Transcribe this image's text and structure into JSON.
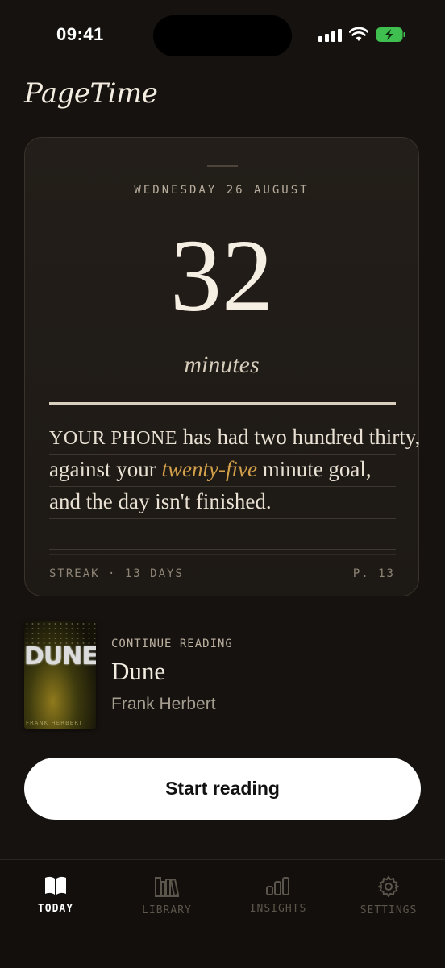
{
  "status_bar": {
    "time": "09:41"
  },
  "app": {
    "title": "PageTime"
  },
  "today_card": {
    "date": "WEDNESDAY 26 AUGUST",
    "minutes": "32",
    "unit": "minutes",
    "quote": {
      "line1_caps": "YOUR PHONE",
      "line1_rest": " has had two hundred thirty,",
      "line2_pre": "against your ",
      "line2_accent": "twenty-five",
      "line2_post": " minute goal,",
      "line3": "and the day isn't finished."
    },
    "streak": "STREAK · 13 DAYS",
    "page": "P. 13"
  },
  "continue_reading": {
    "label": "CONTINUE READING",
    "book_title": "Dune",
    "book_author": "Frank Herbert",
    "cover_title": "DUNE",
    "cover_author": "FRANK HERBERT"
  },
  "primary_action": {
    "label": "Start reading"
  },
  "tabs": [
    {
      "label": "TODAY",
      "icon": "book-open-icon",
      "active": true
    },
    {
      "label": "LIBRARY",
      "icon": "books-shelf-icon",
      "active": false
    },
    {
      "label": "INSIGHTS",
      "icon": "bar-chart-icon",
      "active": false
    },
    {
      "label": "SETTINGS",
      "icon": "gear-icon",
      "active": false
    }
  ],
  "colors": {
    "accent": "#d4a04a",
    "background": "#16120f",
    "card": "#211c18"
  }
}
